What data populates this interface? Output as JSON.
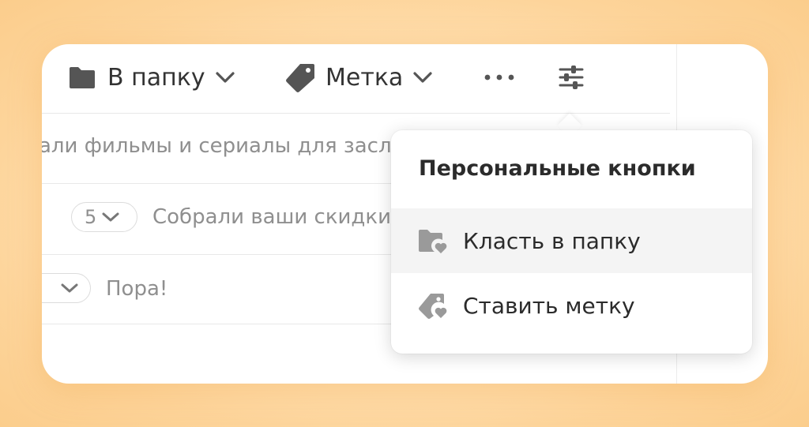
{
  "toolbar": {
    "folder_label": "В папку",
    "label_label": "Метка"
  },
  "messages": [
    {
      "subject": "али фильмы и сериалы для засл"
    },
    {
      "count": "5",
      "subject": "Собрали ваши скидки"
    },
    {
      "subject": "Пора!"
    }
  ],
  "popup": {
    "title": "Персональные кнопки",
    "items": [
      {
        "label": "Класть в папку",
        "icon": "folder-heart-icon",
        "highlighted": true
      },
      {
        "label": "Ставить метку",
        "icon": "tag-heart-icon",
        "highlighted": false
      }
    ]
  },
  "colors": {
    "icon": "#555555",
    "menu_icon": "#9a9a9a",
    "text": "#333333",
    "muted_text": "#8f8f8f",
    "hover": "#f4f4f4"
  }
}
